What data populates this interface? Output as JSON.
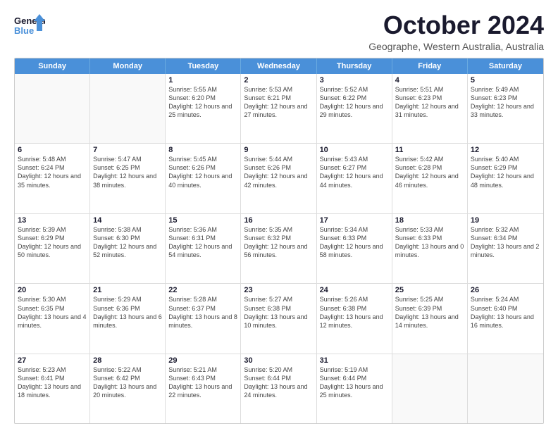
{
  "logo": {
    "line1": "General",
    "line2": "Blue"
  },
  "title": "October 2024",
  "subtitle": "Geographe, Western Australia, Australia",
  "days": [
    "Sunday",
    "Monday",
    "Tuesday",
    "Wednesday",
    "Thursday",
    "Friday",
    "Saturday"
  ],
  "weeks": [
    [
      {
        "day": "",
        "info": ""
      },
      {
        "day": "",
        "info": ""
      },
      {
        "day": "1",
        "info": "Sunrise: 5:55 AM\nSunset: 6:20 PM\nDaylight: 12 hours and 25 minutes."
      },
      {
        "day": "2",
        "info": "Sunrise: 5:53 AM\nSunset: 6:21 PM\nDaylight: 12 hours and 27 minutes."
      },
      {
        "day": "3",
        "info": "Sunrise: 5:52 AM\nSunset: 6:22 PM\nDaylight: 12 hours and 29 minutes."
      },
      {
        "day": "4",
        "info": "Sunrise: 5:51 AM\nSunset: 6:23 PM\nDaylight: 12 hours and 31 minutes."
      },
      {
        "day": "5",
        "info": "Sunrise: 5:49 AM\nSunset: 6:23 PM\nDaylight: 12 hours and 33 minutes."
      }
    ],
    [
      {
        "day": "6",
        "info": "Sunrise: 5:48 AM\nSunset: 6:24 PM\nDaylight: 12 hours and 35 minutes."
      },
      {
        "day": "7",
        "info": "Sunrise: 5:47 AM\nSunset: 6:25 PM\nDaylight: 12 hours and 38 minutes."
      },
      {
        "day": "8",
        "info": "Sunrise: 5:45 AM\nSunset: 6:26 PM\nDaylight: 12 hours and 40 minutes."
      },
      {
        "day": "9",
        "info": "Sunrise: 5:44 AM\nSunset: 6:26 PM\nDaylight: 12 hours and 42 minutes."
      },
      {
        "day": "10",
        "info": "Sunrise: 5:43 AM\nSunset: 6:27 PM\nDaylight: 12 hours and 44 minutes."
      },
      {
        "day": "11",
        "info": "Sunrise: 5:42 AM\nSunset: 6:28 PM\nDaylight: 12 hours and 46 minutes."
      },
      {
        "day": "12",
        "info": "Sunrise: 5:40 AM\nSunset: 6:29 PM\nDaylight: 12 hours and 48 minutes."
      }
    ],
    [
      {
        "day": "13",
        "info": "Sunrise: 5:39 AM\nSunset: 6:29 PM\nDaylight: 12 hours and 50 minutes."
      },
      {
        "day": "14",
        "info": "Sunrise: 5:38 AM\nSunset: 6:30 PM\nDaylight: 12 hours and 52 minutes."
      },
      {
        "day": "15",
        "info": "Sunrise: 5:36 AM\nSunset: 6:31 PM\nDaylight: 12 hours and 54 minutes."
      },
      {
        "day": "16",
        "info": "Sunrise: 5:35 AM\nSunset: 6:32 PM\nDaylight: 12 hours and 56 minutes."
      },
      {
        "day": "17",
        "info": "Sunrise: 5:34 AM\nSunset: 6:33 PM\nDaylight: 12 hours and 58 minutes."
      },
      {
        "day": "18",
        "info": "Sunrise: 5:33 AM\nSunset: 6:33 PM\nDaylight: 13 hours and 0 minutes."
      },
      {
        "day": "19",
        "info": "Sunrise: 5:32 AM\nSunset: 6:34 PM\nDaylight: 13 hours and 2 minutes."
      }
    ],
    [
      {
        "day": "20",
        "info": "Sunrise: 5:30 AM\nSunset: 6:35 PM\nDaylight: 13 hours and 4 minutes."
      },
      {
        "day": "21",
        "info": "Sunrise: 5:29 AM\nSunset: 6:36 PM\nDaylight: 13 hours and 6 minutes."
      },
      {
        "day": "22",
        "info": "Sunrise: 5:28 AM\nSunset: 6:37 PM\nDaylight: 13 hours and 8 minutes."
      },
      {
        "day": "23",
        "info": "Sunrise: 5:27 AM\nSunset: 6:38 PM\nDaylight: 13 hours and 10 minutes."
      },
      {
        "day": "24",
        "info": "Sunrise: 5:26 AM\nSunset: 6:38 PM\nDaylight: 13 hours and 12 minutes."
      },
      {
        "day": "25",
        "info": "Sunrise: 5:25 AM\nSunset: 6:39 PM\nDaylight: 13 hours and 14 minutes."
      },
      {
        "day": "26",
        "info": "Sunrise: 5:24 AM\nSunset: 6:40 PM\nDaylight: 13 hours and 16 minutes."
      }
    ],
    [
      {
        "day": "27",
        "info": "Sunrise: 5:23 AM\nSunset: 6:41 PM\nDaylight: 13 hours and 18 minutes."
      },
      {
        "day": "28",
        "info": "Sunrise: 5:22 AM\nSunset: 6:42 PM\nDaylight: 13 hours and 20 minutes."
      },
      {
        "day": "29",
        "info": "Sunrise: 5:21 AM\nSunset: 6:43 PM\nDaylight: 13 hours and 22 minutes."
      },
      {
        "day": "30",
        "info": "Sunrise: 5:20 AM\nSunset: 6:44 PM\nDaylight: 13 hours and 24 minutes."
      },
      {
        "day": "31",
        "info": "Sunrise: 5:19 AM\nSunset: 6:44 PM\nDaylight: 13 hours and 25 minutes."
      },
      {
        "day": "",
        "info": ""
      },
      {
        "day": "",
        "info": ""
      }
    ]
  ]
}
